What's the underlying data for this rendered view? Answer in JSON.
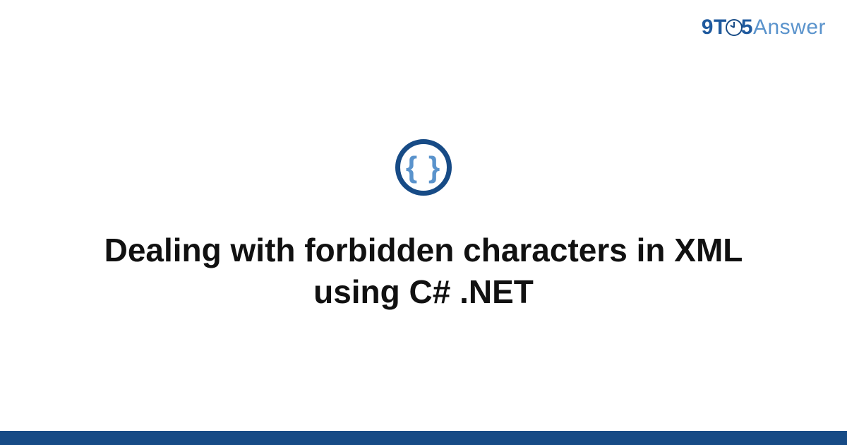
{
  "logo": {
    "nine": "9",
    "t": "T",
    "five": "5",
    "answer": "Answer"
  },
  "icon": {
    "braces": "{ }"
  },
  "title": "Dealing with forbidden characters in XML using C# .NET",
  "colors": {
    "primary_dark": "#174b86",
    "primary_mid": "#1f5a9e",
    "primary_light": "#5a93cc"
  }
}
